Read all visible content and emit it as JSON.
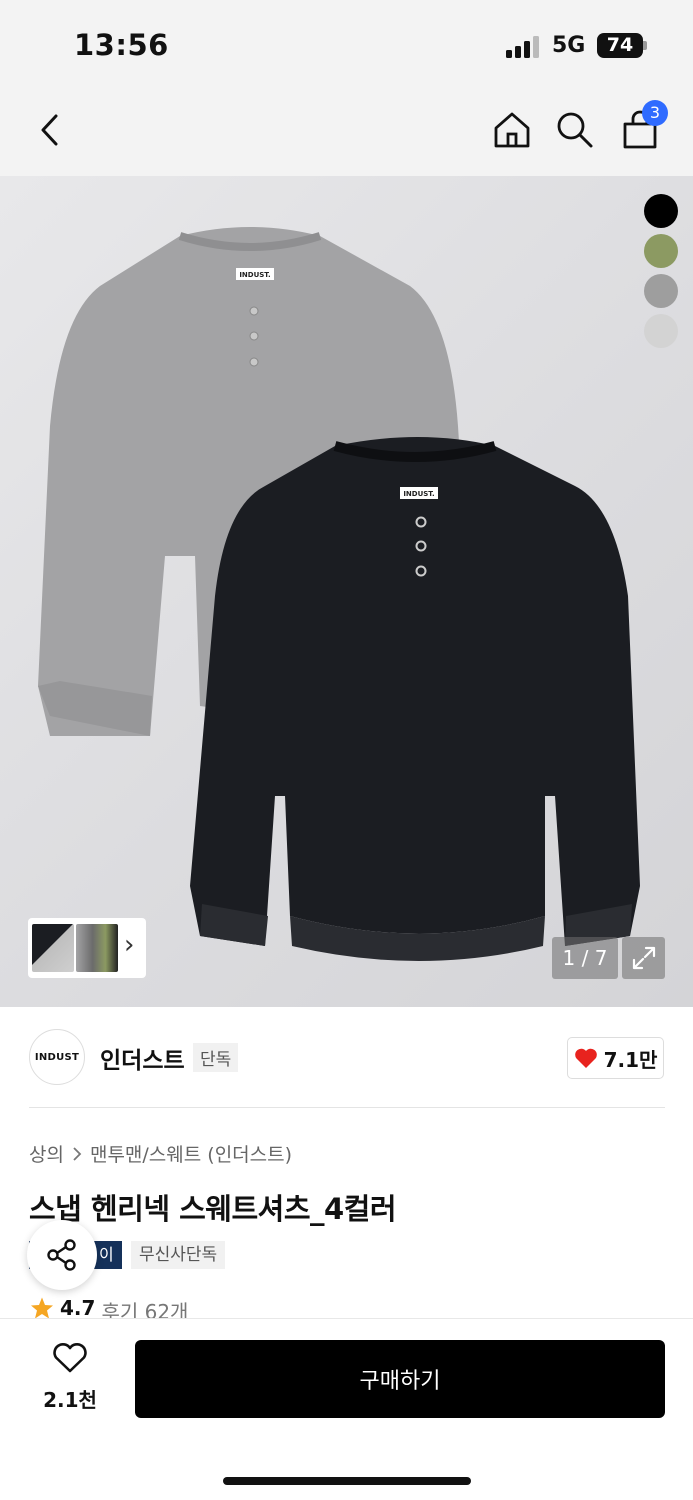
{
  "status_bar": {
    "time": "13:56",
    "network": "5G",
    "battery": "74"
  },
  "nav": {
    "back_icon": "chevron-left-icon",
    "home_icon": "home-icon",
    "search_icon": "search-icon",
    "cart_icon": "shopping-bag-icon",
    "cart_count": "3"
  },
  "gallery": {
    "color_swatches": [
      "#000000",
      "#8c9a62",
      "#9e9e9e",
      "#d3d3d3"
    ],
    "counter": "1 / 7",
    "expand_icon": "expand-icon",
    "thumb_arrow": "›",
    "product_label": "INDUST."
  },
  "brand": {
    "logo_text": "INDUST",
    "name": "인더스트",
    "tag": "단독",
    "likes": "7.1만",
    "like_color": "#e8231e"
  },
  "product": {
    "breadcrumb": [
      "상의",
      "맨투맨/스웨트 (인더스트)"
    ],
    "title": "스냅 헨리넥 스웨트셔츠_4컬러",
    "tags": [
      "이",
      "무신사단독"
    ],
    "rating": "4.7",
    "review_text": "후기 62개"
  },
  "bottom": {
    "wish_count": "2.1천",
    "buy_label": "구매하기"
  },
  "colors": {
    "accent": "#2f6bff",
    "buy_bg": "#000000",
    "star": "#f5a623"
  }
}
